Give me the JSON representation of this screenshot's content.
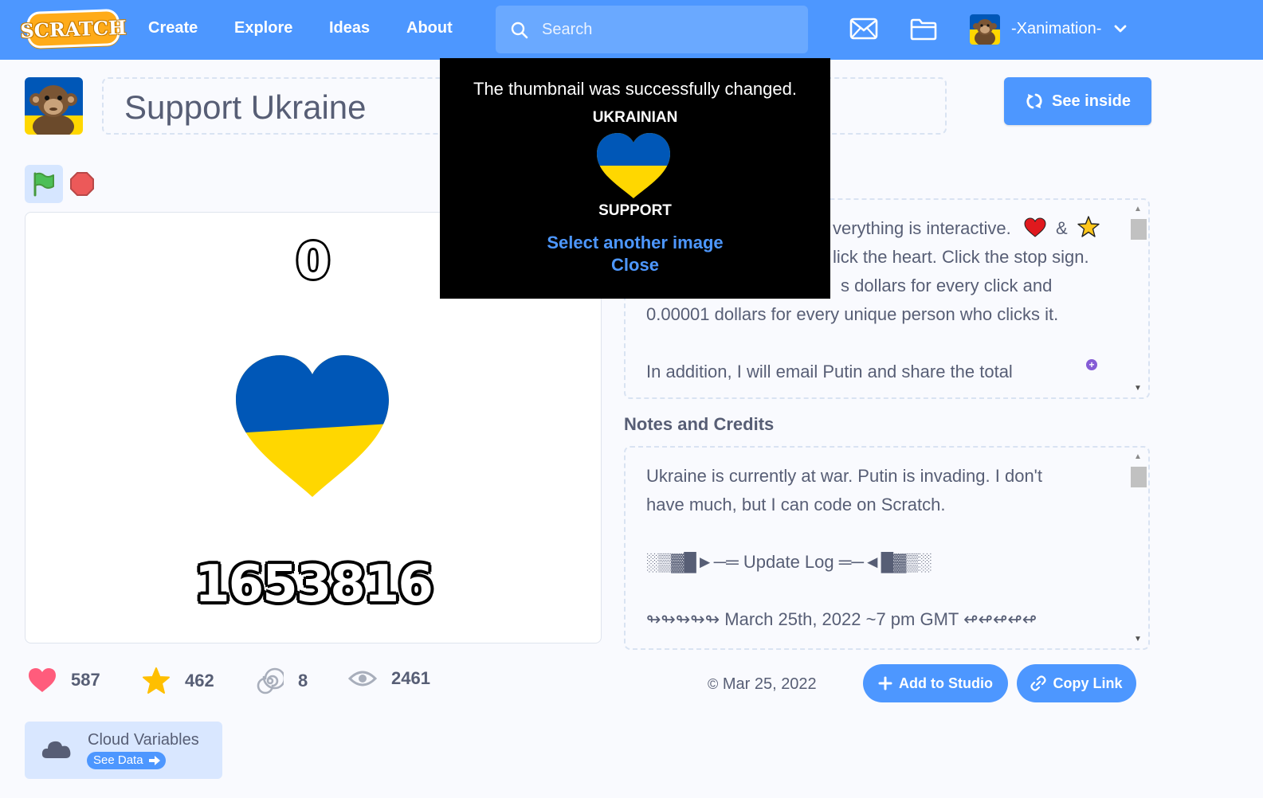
{
  "nav": {
    "logo": "SCRATCH",
    "links": [
      "Create",
      "Explore",
      "Ideas",
      "About"
    ],
    "search_placeholder": "Search",
    "username": "-Xanimation-"
  },
  "project": {
    "title": "Support Ukraine",
    "see_inside": "See inside"
  },
  "stage": {
    "counter_top": "0",
    "counter_bottom": "1653816"
  },
  "instructions": {
    "lines": [
      "verything is interactive.",
      "lick the heart. Click the stop sign.",
      "s dollars for every click and",
      "0.00001 dollars for every unique person who clicks it.",
      "",
      "In addition, I will email Putin and share the total"
    ],
    "amp": "&"
  },
  "notes": {
    "heading": "Notes and Credits",
    "lines": [
      "Ukraine is currently at war. Putin is invading. I don't",
      "have much, but I can code on Scratch.",
      "",
      "░▒▓█►─═ Update Log ═─◄█▓▒░",
      "",
      "↬↬↬↬↬ March 25th, 2022 ~7 pm GMT ↫↫↫↫↫"
    ]
  },
  "stats": {
    "loves": "587",
    "favorites": "462",
    "remixes": "8",
    "views": "2461",
    "date": "Mar 25, 2022"
  },
  "actions": {
    "add_to_studio": "Add to Studio",
    "copy_link": "Copy Link"
  },
  "cloud": {
    "title": "Cloud Variables",
    "button": "See Data"
  },
  "modal": {
    "message": "The thumbnail was successfully changed.",
    "label_top": "UKRAINIAN",
    "label_bottom": "SUPPORT",
    "select_link": "Select another image",
    "close_link": "Close"
  },
  "colors": {
    "brand_blue": "#4d97ff",
    "ukraine_blue": "#0057b7",
    "ukraine_yellow": "#ffd700",
    "love_red": "#ff5c7c",
    "star_yellow": "#ffbf00"
  }
}
